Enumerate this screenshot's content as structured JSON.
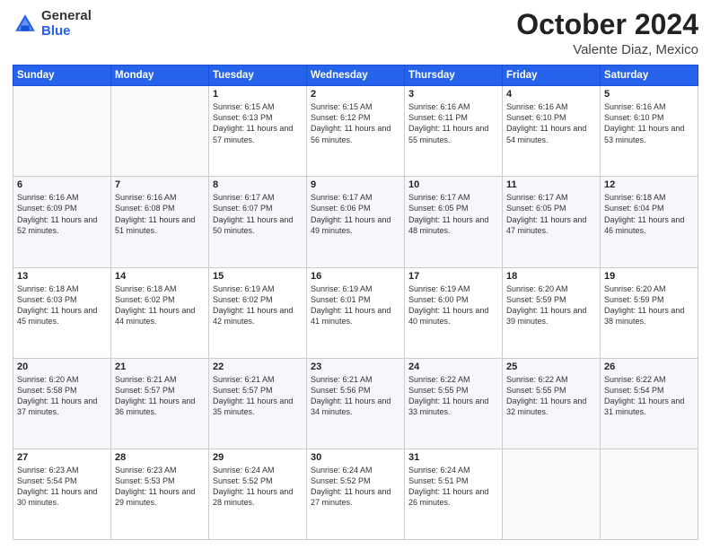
{
  "header": {
    "logo_general": "General",
    "logo_blue": "Blue",
    "title": "October 2024",
    "location": "Valente Diaz, Mexico"
  },
  "weekdays": [
    "Sunday",
    "Monday",
    "Tuesday",
    "Wednesday",
    "Thursday",
    "Friday",
    "Saturday"
  ],
  "weeks": [
    [
      {
        "day": "",
        "sunrise": "",
        "sunset": "",
        "daylight": ""
      },
      {
        "day": "",
        "sunrise": "",
        "sunset": "",
        "daylight": ""
      },
      {
        "day": "1",
        "sunrise": "Sunrise: 6:15 AM",
        "sunset": "Sunset: 6:13 PM",
        "daylight": "Daylight: 11 hours and 57 minutes."
      },
      {
        "day": "2",
        "sunrise": "Sunrise: 6:15 AM",
        "sunset": "Sunset: 6:12 PM",
        "daylight": "Daylight: 11 hours and 56 minutes."
      },
      {
        "day": "3",
        "sunrise": "Sunrise: 6:16 AM",
        "sunset": "Sunset: 6:11 PM",
        "daylight": "Daylight: 11 hours and 55 minutes."
      },
      {
        "day": "4",
        "sunrise": "Sunrise: 6:16 AM",
        "sunset": "Sunset: 6:10 PM",
        "daylight": "Daylight: 11 hours and 54 minutes."
      },
      {
        "day": "5",
        "sunrise": "Sunrise: 6:16 AM",
        "sunset": "Sunset: 6:10 PM",
        "daylight": "Daylight: 11 hours and 53 minutes."
      }
    ],
    [
      {
        "day": "6",
        "sunrise": "Sunrise: 6:16 AM",
        "sunset": "Sunset: 6:09 PM",
        "daylight": "Daylight: 11 hours and 52 minutes."
      },
      {
        "day": "7",
        "sunrise": "Sunrise: 6:16 AM",
        "sunset": "Sunset: 6:08 PM",
        "daylight": "Daylight: 11 hours and 51 minutes."
      },
      {
        "day": "8",
        "sunrise": "Sunrise: 6:17 AM",
        "sunset": "Sunset: 6:07 PM",
        "daylight": "Daylight: 11 hours and 50 minutes."
      },
      {
        "day": "9",
        "sunrise": "Sunrise: 6:17 AM",
        "sunset": "Sunset: 6:06 PM",
        "daylight": "Daylight: 11 hours and 49 minutes."
      },
      {
        "day": "10",
        "sunrise": "Sunrise: 6:17 AM",
        "sunset": "Sunset: 6:05 PM",
        "daylight": "Daylight: 11 hours and 48 minutes."
      },
      {
        "day": "11",
        "sunrise": "Sunrise: 6:17 AM",
        "sunset": "Sunset: 6:05 PM",
        "daylight": "Daylight: 11 hours and 47 minutes."
      },
      {
        "day": "12",
        "sunrise": "Sunrise: 6:18 AM",
        "sunset": "Sunset: 6:04 PM",
        "daylight": "Daylight: 11 hours and 46 minutes."
      }
    ],
    [
      {
        "day": "13",
        "sunrise": "Sunrise: 6:18 AM",
        "sunset": "Sunset: 6:03 PM",
        "daylight": "Daylight: 11 hours and 45 minutes."
      },
      {
        "day": "14",
        "sunrise": "Sunrise: 6:18 AM",
        "sunset": "Sunset: 6:02 PM",
        "daylight": "Daylight: 11 hours and 44 minutes."
      },
      {
        "day": "15",
        "sunrise": "Sunrise: 6:19 AM",
        "sunset": "Sunset: 6:02 PM",
        "daylight": "Daylight: 11 hours and 42 minutes."
      },
      {
        "day": "16",
        "sunrise": "Sunrise: 6:19 AM",
        "sunset": "Sunset: 6:01 PM",
        "daylight": "Daylight: 11 hours and 41 minutes."
      },
      {
        "day": "17",
        "sunrise": "Sunrise: 6:19 AM",
        "sunset": "Sunset: 6:00 PM",
        "daylight": "Daylight: 11 hours and 40 minutes."
      },
      {
        "day": "18",
        "sunrise": "Sunrise: 6:20 AM",
        "sunset": "Sunset: 5:59 PM",
        "daylight": "Daylight: 11 hours and 39 minutes."
      },
      {
        "day": "19",
        "sunrise": "Sunrise: 6:20 AM",
        "sunset": "Sunset: 5:59 PM",
        "daylight": "Daylight: 11 hours and 38 minutes."
      }
    ],
    [
      {
        "day": "20",
        "sunrise": "Sunrise: 6:20 AM",
        "sunset": "Sunset: 5:58 PM",
        "daylight": "Daylight: 11 hours and 37 minutes."
      },
      {
        "day": "21",
        "sunrise": "Sunrise: 6:21 AM",
        "sunset": "Sunset: 5:57 PM",
        "daylight": "Daylight: 11 hours and 36 minutes."
      },
      {
        "day": "22",
        "sunrise": "Sunrise: 6:21 AM",
        "sunset": "Sunset: 5:57 PM",
        "daylight": "Daylight: 11 hours and 35 minutes."
      },
      {
        "day": "23",
        "sunrise": "Sunrise: 6:21 AM",
        "sunset": "Sunset: 5:56 PM",
        "daylight": "Daylight: 11 hours and 34 minutes."
      },
      {
        "day": "24",
        "sunrise": "Sunrise: 6:22 AM",
        "sunset": "Sunset: 5:55 PM",
        "daylight": "Daylight: 11 hours and 33 minutes."
      },
      {
        "day": "25",
        "sunrise": "Sunrise: 6:22 AM",
        "sunset": "Sunset: 5:55 PM",
        "daylight": "Daylight: 11 hours and 32 minutes."
      },
      {
        "day": "26",
        "sunrise": "Sunrise: 6:22 AM",
        "sunset": "Sunset: 5:54 PM",
        "daylight": "Daylight: 11 hours and 31 minutes."
      }
    ],
    [
      {
        "day": "27",
        "sunrise": "Sunrise: 6:23 AM",
        "sunset": "Sunset: 5:54 PM",
        "daylight": "Daylight: 11 hours and 30 minutes."
      },
      {
        "day": "28",
        "sunrise": "Sunrise: 6:23 AM",
        "sunset": "Sunset: 5:53 PM",
        "daylight": "Daylight: 11 hours and 29 minutes."
      },
      {
        "day": "29",
        "sunrise": "Sunrise: 6:24 AM",
        "sunset": "Sunset: 5:52 PM",
        "daylight": "Daylight: 11 hours and 28 minutes."
      },
      {
        "day": "30",
        "sunrise": "Sunrise: 6:24 AM",
        "sunset": "Sunset: 5:52 PM",
        "daylight": "Daylight: 11 hours and 27 minutes."
      },
      {
        "day": "31",
        "sunrise": "Sunrise: 6:24 AM",
        "sunset": "Sunset: 5:51 PM",
        "daylight": "Daylight: 11 hours and 26 minutes."
      },
      {
        "day": "",
        "sunrise": "",
        "sunset": "",
        "daylight": ""
      },
      {
        "day": "",
        "sunrise": "",
        "sunset": "",
        "daylight": ""
      }
    ]
  ]
}
